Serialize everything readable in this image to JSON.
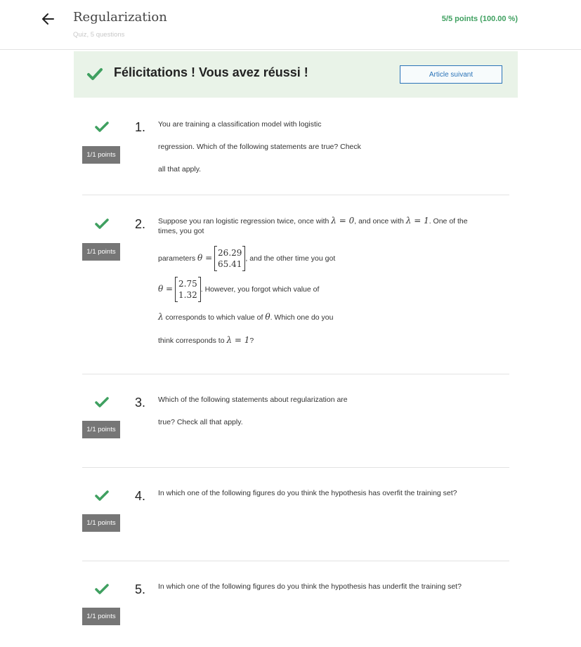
{
  "header": {
    "title": "Regularization",
    "subtitle": "Quiz, 5 questions",
    "score": "5/5 points (100.00 %)"
  },
  "banner": {
    "message": "Félicitations ! Vous avez réussi !",
    "next_label": "Article suivant"
  },
  "colors": {
    "success": "#3fa060",
    "link": "#2a73b8",
    "banner_bg": "#e9f3e8",
    "badge_bg": "#767676"
  },
  "questions": [
    {
      "number": "1.",
      "points": "1/1 points",
      "lines": [
        "You are training a classification model with logistic",
        "regression. Which of the following statements are true? Check",
        "all that apply."
      ]
    },
    {
      "number": "2.",
      "points": "1/1 points",
      "intro_a": "Suppose you ran logistic regression twice, once with ",
      "lambda0": "λ = 0",
      "intro_b": ", and once with ",
      "lambda1": "λ = 1",
      "intro_c": ". One of the times, you got",
      "params_label": "parameters ",
      "theta_eq": "θ =",
      "theta1": [
        "26.29",
        "65.41"
      ],
      "after_theta1": ", and the other time you got",
      "theta2": [
        "2.75",
        "1.32"
      ],
      "after_theta2": ". However, you forgot which value of",
      "lambda_sym": "λ",
      "line4": " corresponds to which value of ",
      "theta_sym": "θ",
      "line4_end": ". Which one do you",
      "line5": "think corresponds to ",
      "lambda_eq1": "λ = 1",
      "line5_end": "?"
    },
    {
      "number": "3.",
      "points": "1/1 points",
      "lines": [
        "Which of the following statements about regularization are",
        "true? Check all that apply."
      ]
    },
    {
      "number": "4.",
      "points": "1/1 points",
      "lines": [
        "In which one of the following figures do you think the hypothesis has overfit the training set?"
      ]
    },
    {
      "number": "5.",
      "points": "1/1 points",
      "lines": [
        "In which one of the following figures do you think the hypothesis has underfit the training set?"
      ]
    }
  ]
}
